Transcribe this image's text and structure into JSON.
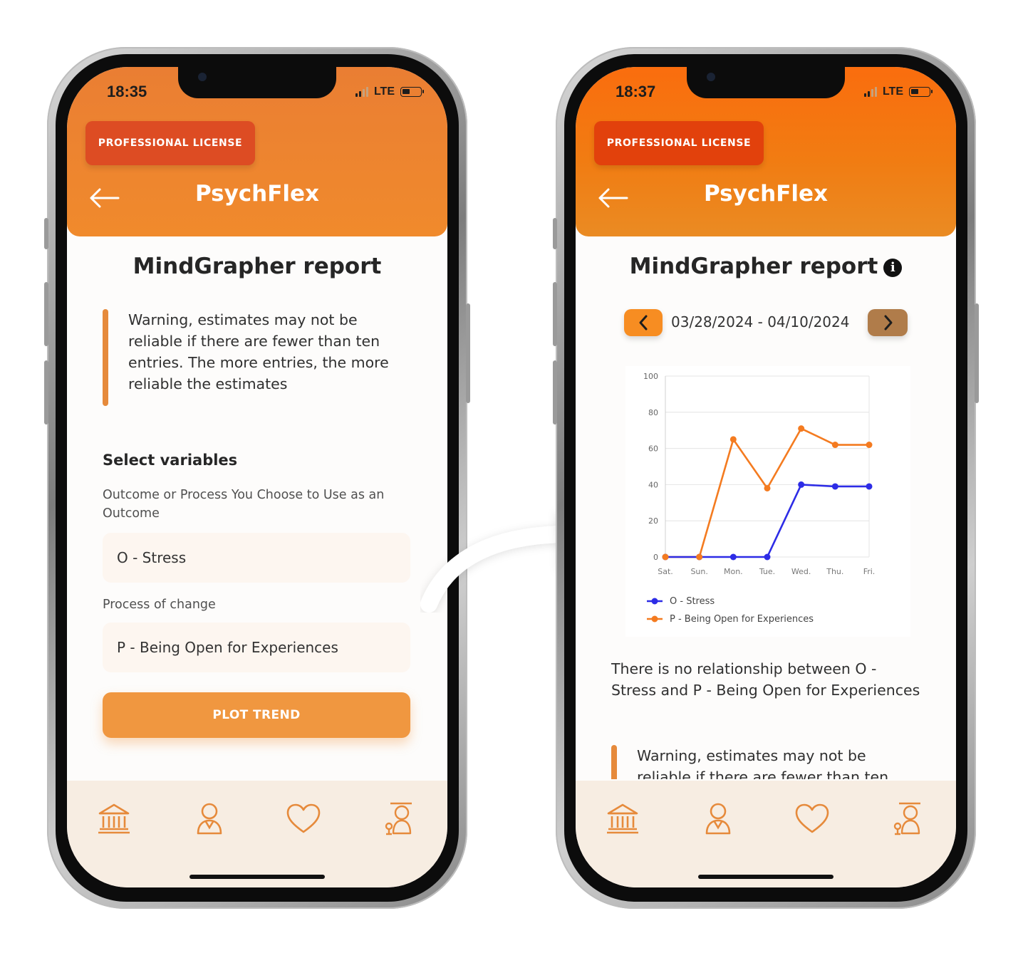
{
  "colors": {
    "header_left": "#f08a2c",
    "header_right": "#f17c12",
    "license_badge": "#dd4c23",
    "accent": "#f09740",
    "tabbar": "#f7ede2",
    "icon": "#e68a3b",
    "series_stress": "#2d2ce6",
    "series_open": "#f47b20"
  },
  "screen1": {
    "status": {
      "time": "18:35",
      "network": "LTE"
    },
    "license": "PROFESSIONAL LICENSE",
    "back_icon": "arrow-left-icon",
    "app_title": "PsychFlex",
    "report_title": "MindGrapher report",
    "warning": "Warning, estimates may not be reliable if there are fewer than ten entries. The more entries, the more reliable the estimates",
    "select_title": "Select variables",
    "outcome_label": "Outcome or Process You Choose to Use as an Outcome",
    "outcome_value": "O - Stress",
    "process_label": "Process of change",
    "process_value": "P - Being Open for Experiences",
    "plot_button": "PLOT TREND",
    "tabs": [
      "bank-icon",
      "user-icon",
      "heart-icon",
      "therapist-icon"
    ]
  },
  "screen2": {
    "status": {
      "time": "18:37",
      "network": "LTE"
    },
    "license": "PROFESSIONAL LICENSE",
    "back_icon": "arrow-left-icon",
    "app_title": "PsychFlex",
    "report_title": "MindGrapher report",
    "info_icon": "i",
    "date_range": "03/28/2024 - 04/10/2024",
    "insight": "There is no relationship between O - Stress and P - Being Open for Experiences",
    "warning_partial": "Warning, estimates may not be reliable if there are fewer than ten",
    "tabs": [
      "bank-icon",
      "user-icon",
      "heart-icon",
      "therapist-icon"
    ]
  },
  "chart_data": {
    "type": "line",
    "categories": [
      "Sat.",
      "Sun.",
      "Mon.",
      "Tue.",
      "Wed.",
      "Thu.",
      "Fri."
    ],
    "ylim": [
      0,
      100
    ],
    "yticks": [
      0,
      20,
      40,
      60,
      80,
      100
    ],
    "grid": true,
    "legend": "bottom-left",
    "series": [
      {
        "name": "O - Stress",
        "color": "#2d2ce6",
        "values": [
          0,
          0,
          0,
          0,
          40,
          39,
          39
        ]
      },
      {
        "name": "P - Being Open for Experiences",
        "color": "#f47b20",
        "values": [
          0,
          0,
          65,
          38,
          71,
          62,
          62
        ]
      }
    ]
  }
}
